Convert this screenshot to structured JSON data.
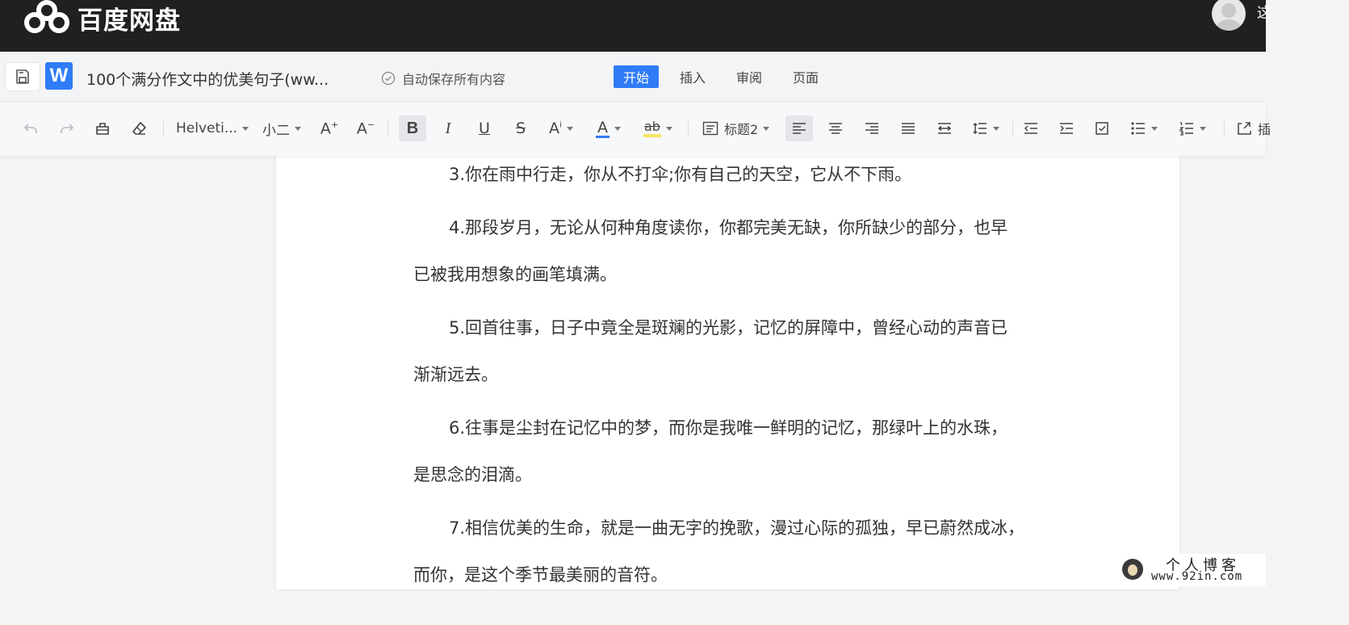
{
  "app": {
    "name": "百度网盘",
    "user_initial": "这"
  },
  "document": {
    "title": "100个满分作文中的优美句子(ww...",
    "autosave": "自动保存所有内容",
    "badge": "W"
  },
  "menu": {
    "tabs": [
      "开始",
      "插入",
      "审阅",
      "页面"
    ],
    "active": "开始"
  },
  "toolbar": {
    "font_family": "Helveti...",
    "font_size": "小二",
    "heading_style": "标题2",
    "icons": [
      "undo-icon",
      "redo-icon",
      "format-painter-icon",
      "eraser-icon",
      "increase-font-icon",
      "decrease-font-icon",
      "bold-icon",
      "italic-icon",
      "underline-icon",
      "strikethrough-icon",
      "superscript-icon",
      "font-color-icon",
      "highlight-icon",
      "style-icon",
      "align-left-icon",
      "align-center-icon",
      "align-right-icon",
      "justify-icon",
      "distribute-icon",
      "line-spacing-icon",
      "outdent-icon",
      "indent-icon",
      "checklist-icon",
      "bullet-list-icon",
      "numbered-list-icon",
      "insert-icon"
    ],
    "font_color": "#2f7cf6",
    "highlight_color": "#f5e663",
    "overflow_text": "插"
  },
  "colors": {
    "accent": "#2f7cf6",
    "topbar": "#202020"
  },
  "content": {
    "paragraphs": [
      {
        "line1": "3.你在雨中行走，你从不打伞;你有自己的天空，它从不下雨。",
        "line2": ""
      },
      {
        "line1": "4.那段岁月，无论从何种角度读你，你都完美无缺，你所缺少的部分，也早",
        "line2": "已被我用想象的画笔填满。"
      },
      {
        "line1": "5.回首往事，日子中竟全是斑斓的光影，记忆的屏障中，曾经心动的声音已",
        "line2": "渐渐远去。"
      },
      {
        "line1": "6.往事是尘封在记忆中的梦，而你是我唯一鲜明的记忆，那绿叶上的水珠，",
        "line2": "是思念的泪滴。"
      },
      {
        "line1": "7.相信优美的生命，就是一曲无字的挽歌，漫过心际的孤独，早已蔚然成冰，",
        "line2": "而你，是这个季节最美丽的音符。"
      }
    ]
  },
  "watermark": {
    "title": "个人博客",
    "url": "www.92in.com"
  }
}
